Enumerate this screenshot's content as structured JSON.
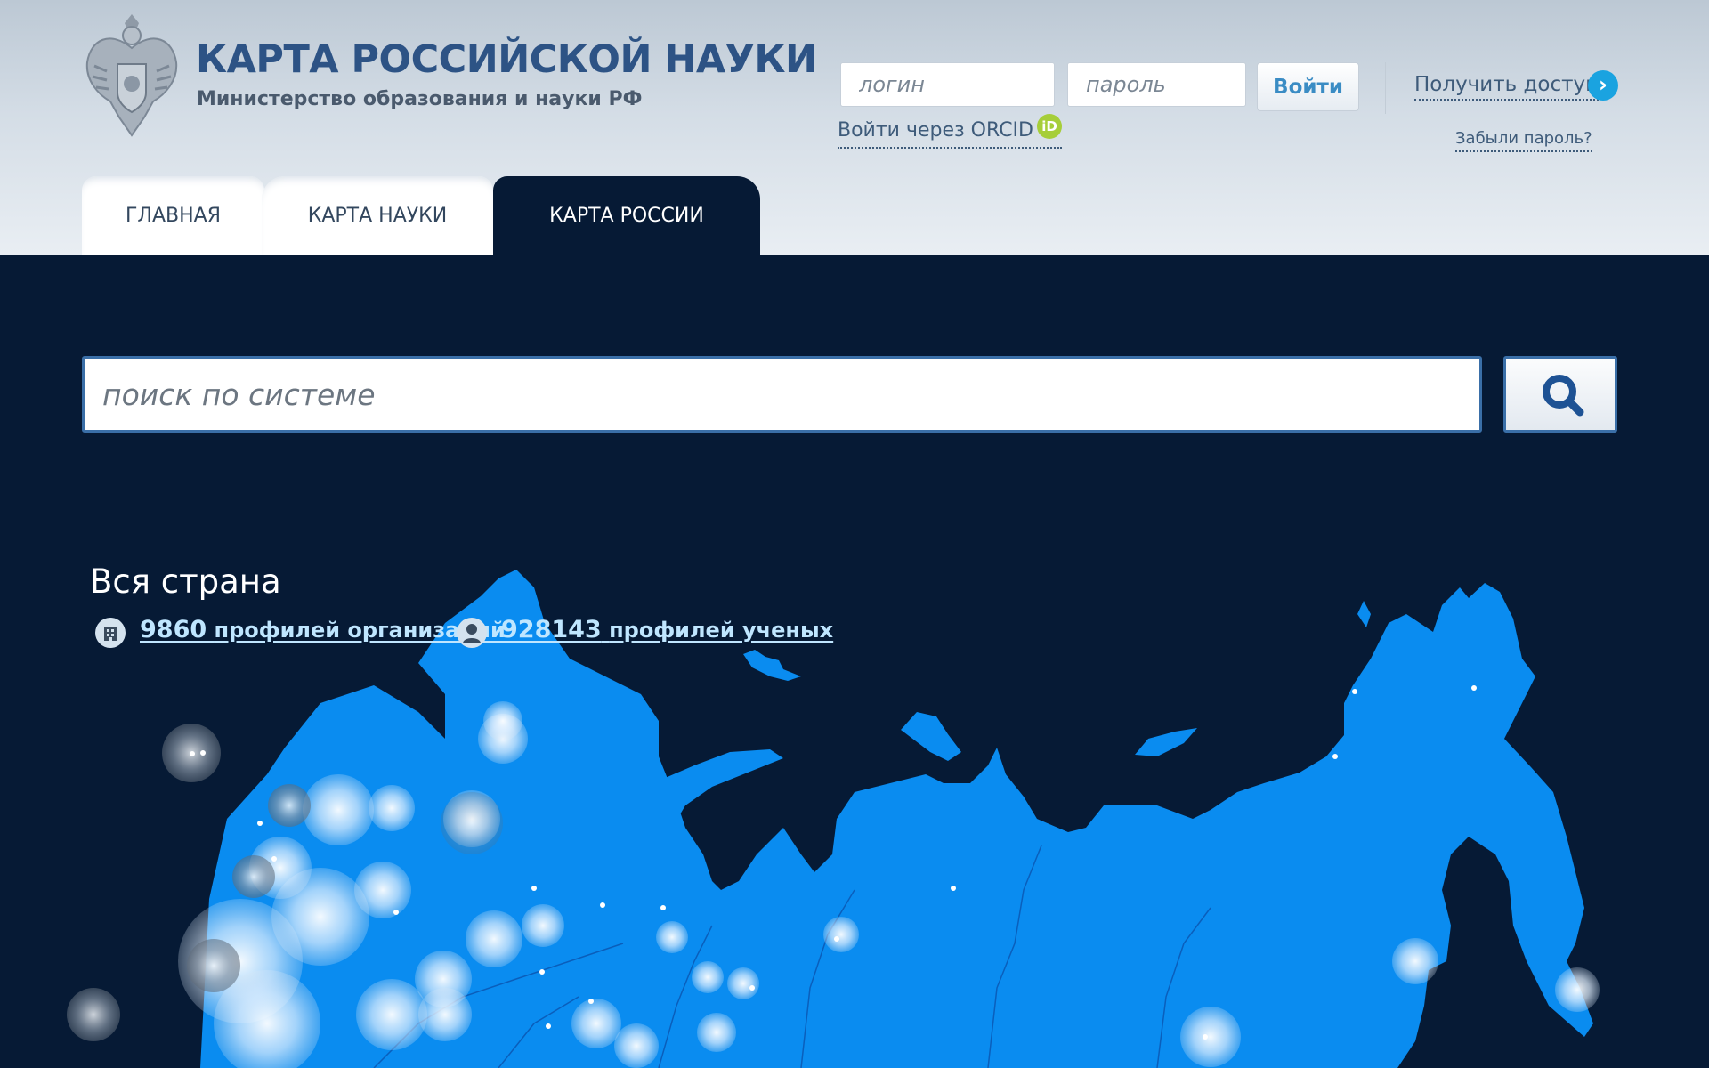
{
  "header": {
    "title": "КАРТА РОССИЙСКОЙ НАУКИ",
    "subtitle": "Министерство образования и науки РФ"
  },
  "auth": {
    "login_placeholder": "логин",
    "password_placeholder": "пароль",
    "login_button": "Войти",
    "orcid_link": "Войти через ORCID",
    "orcid_icon_text": "iD",
    "get_access": "Получить доступ",
    "forgot_password": "Забыли пароль?"
  },
  "tabs": [
    {
      "label": "ГЛАВНАЯ",
      "active": false
    },
    {
      "label": "КАРТА НАУКИ",
      "active": false
    },
    {
      "label": "КАРТА РОССИИ",
      "active": true
    }
  ],
  "search": {
    "placeholder": "поиск по системе"
  },
  "region": {
    "title": "Вся страна",
    "organizations": {
      "count": "9860",
      "label": "профилей организаций"
    },
    "scientists": {
      "count": "928143",
      "label": "профилей ученых"
    }
  },
  "colors": {
    "background": "#061a35",
    "land": "#0a8cf0",
    "title": "#2d5385",
    "link": "#bfe6ff",
    "orcid": "#a6ce39",
    "access": "#1aa3e0"
  },
  "icons": [
    "emblem",
    "orcid-icon",
    "chevron-right-icon",
    "search-icon",
    "building-icon",
    "user-icon"
  ]
}
